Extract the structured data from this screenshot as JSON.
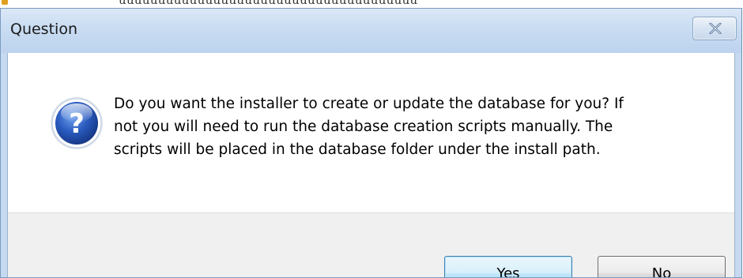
{
  "dialog": {
    "title": "Question",
    "close_label": "Close",
    "message_lines": [
      "Do you want the installer to create or update the database for you? If",
      "not you will need to run the database creation scripts manually. The",
      "scripts will be placed in the database folder under the install path."
    ],
    "icon": "question-icon",
    "buttons": {
      "yes_label": "Yes",
      "no_label": "No"
    }
  },
  "colors": {
    "title_bar": "#c9dcf2",
    "window_border": "#7a9bbf",
    "button_bar": "#f0f0f0",
    "default_button_border": "#3c7fb1",
    "icon_blue": "#2a5bbf"
  }
}
